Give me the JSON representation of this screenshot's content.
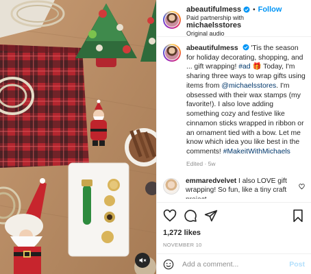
{
  "header": {
    "username": "abeautifulmess",
    "follow_label": "Follow",
    "separator": "•",
    "partnership_label": "Paid partnership with",
    "partner": "michaelsstores",
    "audio": "Original audio"
  },
  "caption": {
    "username": "abeautifulmess",
    "text_1": "'Tis the season for holiday decorating, shopping, and ... gift wrapping! ",
    "hashtag_ad": "#ad",
    "emoji": "🎁",
    "text_2": " Today, I'm sharing three ways to wrap gifts using items from ",
    "mention": "@michaelsstores",
    "text_3": ". I'm obsessed with their wax stamps (my favorite!). I also love adding something cozy and festive like cinnamon sticks wrapped in ribbon or an ornament tied with a bow. Let me know which idea you like best in the comments! ",
    "hashtag": "#MakeitWithMichaels",
    "edited": "Edited",
    "time": "5w"
  },
  "comment": {
    "username": "emmaredvelvet",
    "text": "I also LOVE gift wrapping! So fun, like a tiny craft project"
  },
  "actions": {
    "likes": "1,272 likes",
    "date": "NOVEMBER 10"
  },
  "composer": {
    "placeholder": "Add a comment...",
    "post_label": "Post"
  },
  "icons": {
    "verified": "verified-badge-icon",
    "like": "heart-icon",
    "comment": "comment-icon",
    "share": "send-icon",
    "save": "bookmark-icon",
    "emoji": "emoji-icon",
    "mute": "speaker-muted-icon"
  },
  "colors": {
    "link": "#0095f6",
    "hashtag": "#00376b",
    "muted_text": "#8e8e8e",
    "post_disabled": "#b2dffc"
  }
}
